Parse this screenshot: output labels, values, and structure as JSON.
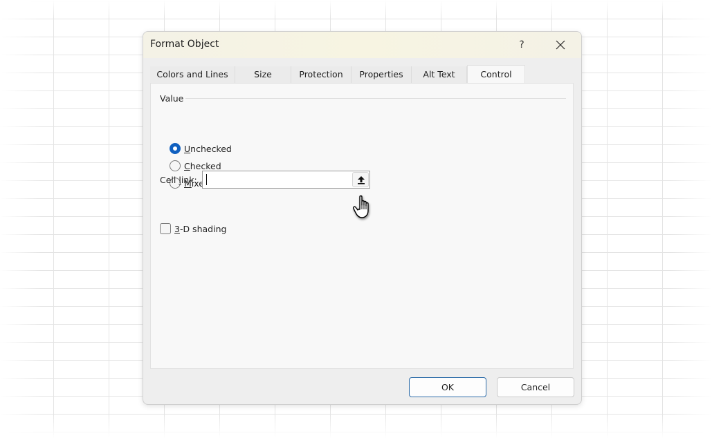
{
  "dialog": {
    "title": "Format Object",
    "help_label": "?",
    "close_icon": "close-icon"
  },
  "tabs": [
    {
      "label": "Colors and Lines",
      "active": false
    },
    {
      "label": "Size",
      "active": false
    },
    {
      "label": "Protection",
      "active": false
    },
    {
      "label": "Properties",
      "active": false
    },
    {
      "label": "Alt Text",
      "active": false
    },
    {
      "label": "Control",
      "active": true
    }
  ],
  "value_group": {
    "label": "Value",
    "options": [
      {
        "access_key": "U",
        "rest": "nchecked",
        "label": "Unchecked",
        "selected": true
      },
      {
        "access_key": "C",
        "rest": "hecked",
        "label": "Checked",
        "selected": false
      },
      {
        "access_key": "M",
        "rest": "ixed",
        "label": "Mixed",
        "selected": false
      }
    ]
  },
  "cell_link": {
    "label_pre": "Cell ",
    "label_key": "l",
    "label_post": "ink:",
    "value": "",
    "collapse_icon": "upload-arrow-icon"
  },
  "shading": {
    "access_key": "3",
    "rest": "-D shading",
    "checked": false
  },
  "buttons": {
    "ok": "OK",
    "cancel": "Cancel"
  },
  "colors": {
    "accent": "#1060c0",
    "ok_border": "#2c6ba8",
    "titlebar": "#f7f4e2"
  }
}
